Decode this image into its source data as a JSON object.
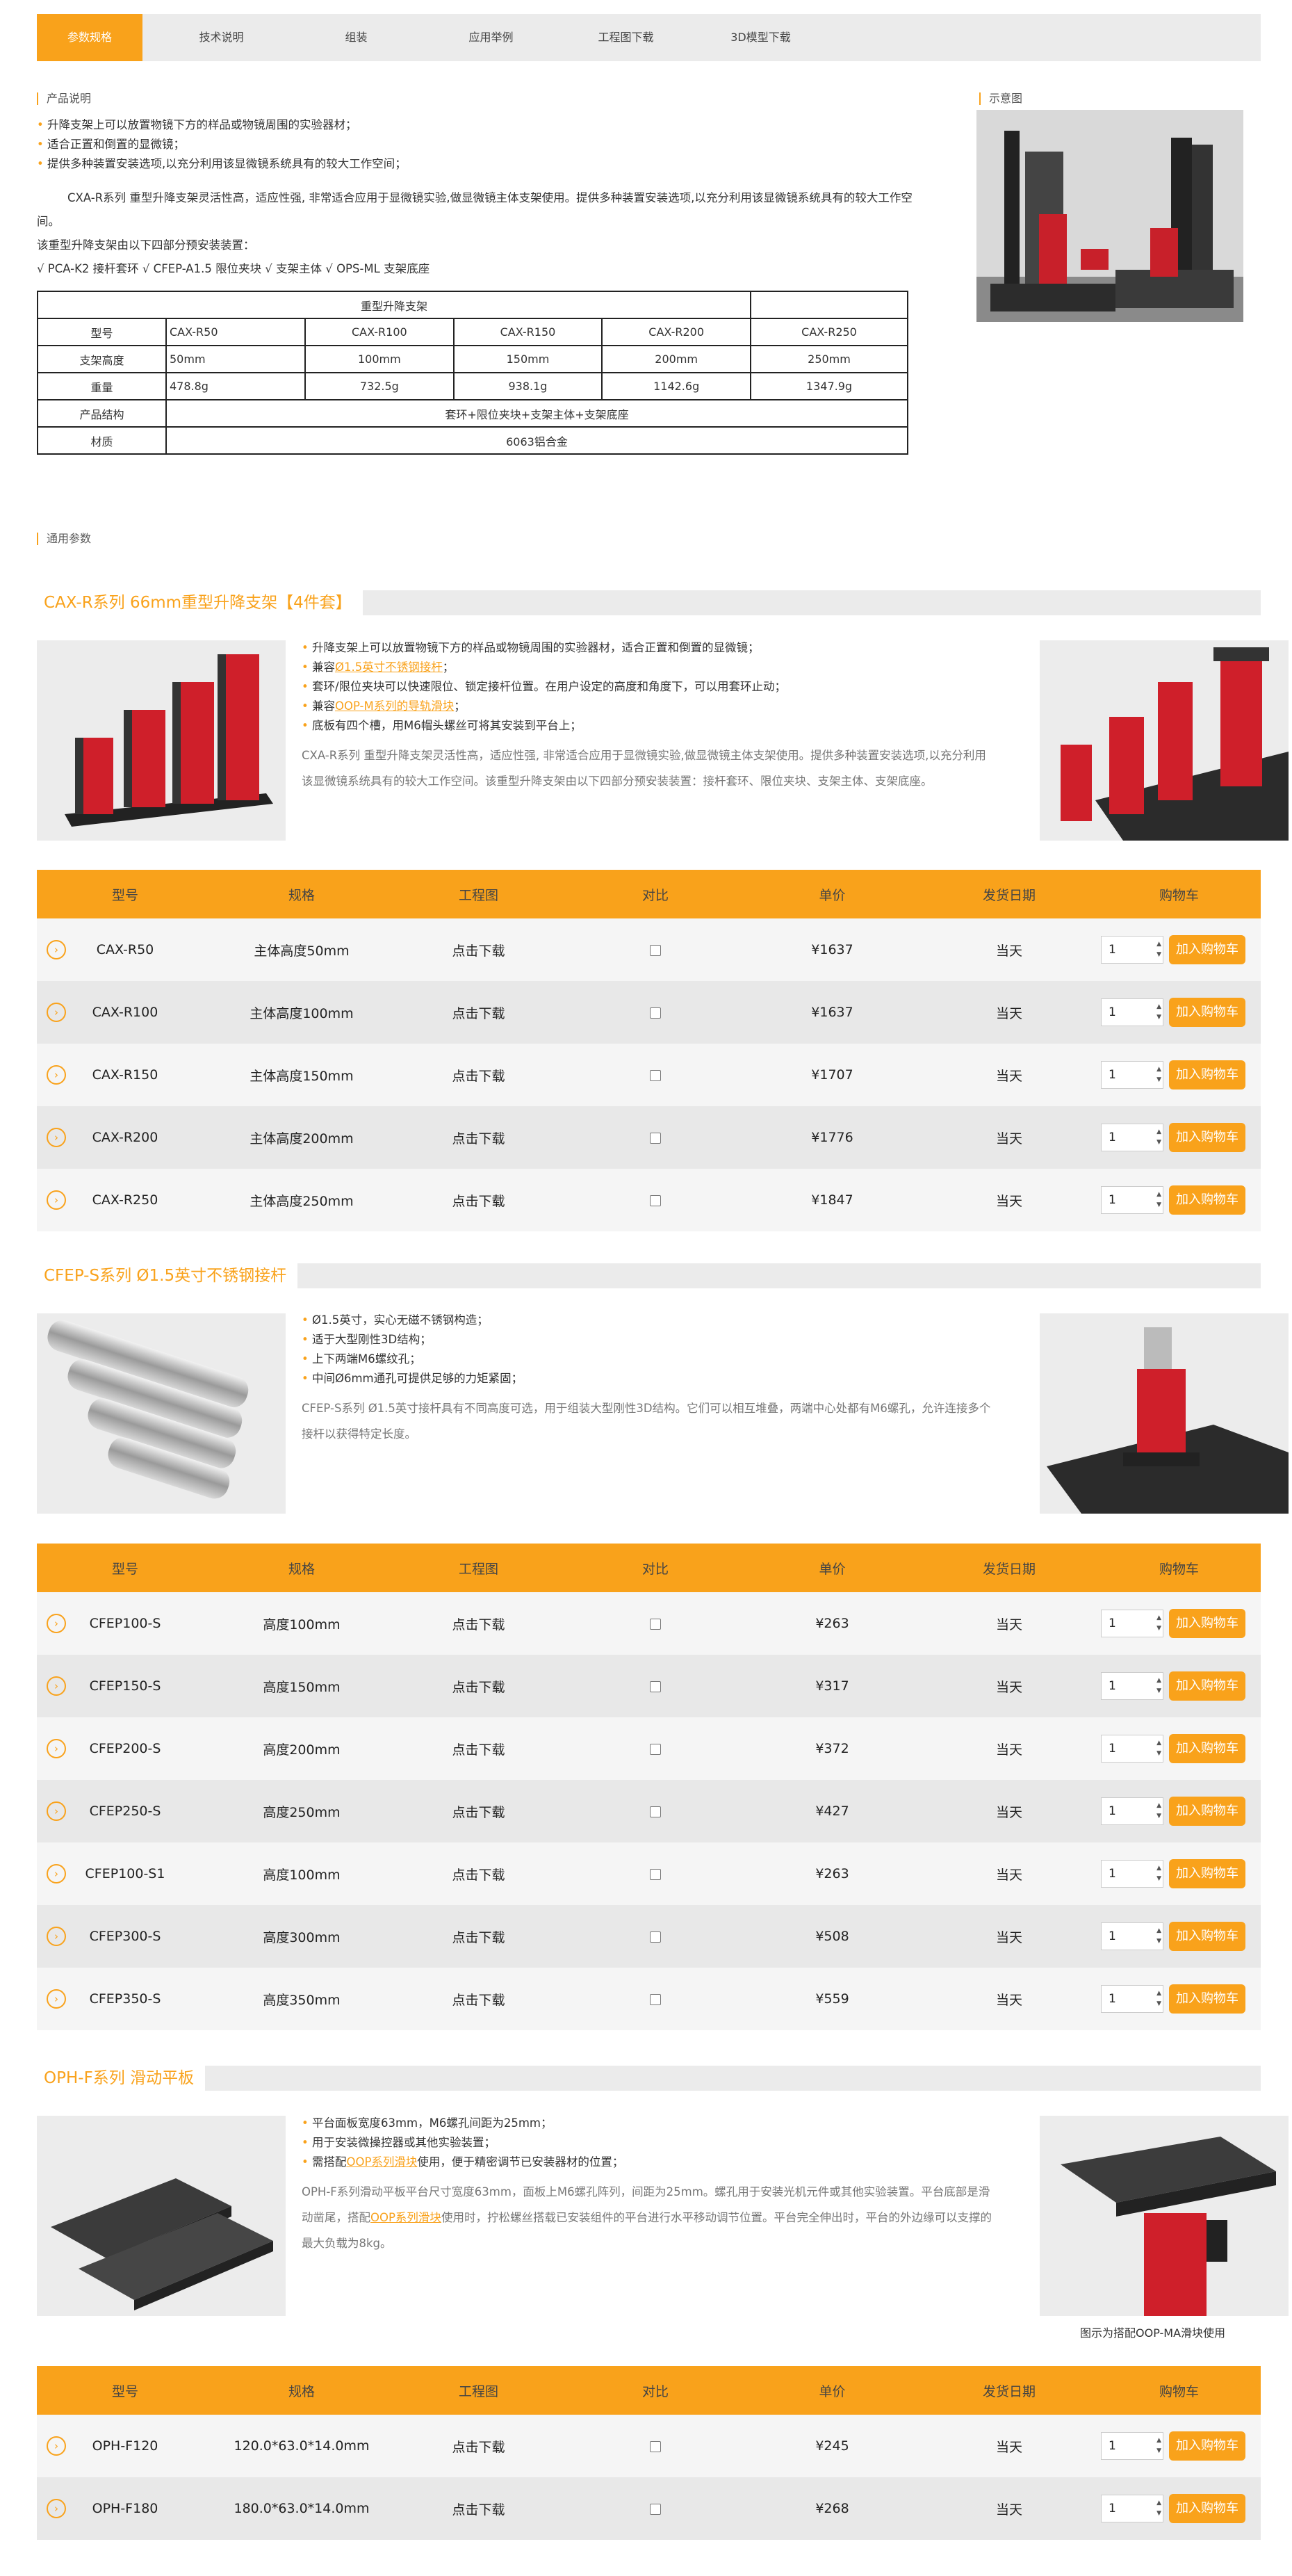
{
  "tabs": [
    "参数规格",
    "技术说明",
    "组装",
    "应用举例",
    "工程图下载",
    "3D模型下载"
  ],
  "sections": {
    "product_desc": "产品说明",
    "illustration": "示意图",
    "general": "通用参数"
  },
  "intro": {
    "bullets": [
      "升降支架上可以放置物镜下方的样品或物镜周围的实验器材；",
      "适合正置和倒置的显微镜；",
      "提供多种装置安装选项,以充分利用该显微镜系统具有的较大工作空间；"
    ],
    "para": "CXA-R系列 重型升降支架灵活性高，适应性强, 非常适合应用于显微镜实验,做显微镜主体支架使用。提供多种装置安装选项,以充分利用该显微镜系统具有的较大工作空间。",
    "para2": "该重型升降支架由以下四部分预安装装置：",
    "parts": "√ PCA-K2 接杆套环  √ CFEP-A1.5 限位夹块  √ 支架主体  √ OPS-ML 支架底座"
  },
  "spec": {
    "title": "重型升降支架",
    "row_model": [
      "型号",
      "CAX-R50",
      "CAX-R100",
      "CAX-R150",
      "CAX-R200",
      "CAX-R250"
    ],
    "row_height": [
      "支架高度",
      "50mm",
      "100mm",
      "150mm",
      "200mm",
      "250mm"
    ],
    "row_weight": [
      "重量",
      "478.8g",
      "732.5g",
      "938.1g",
      "1142.6g",
      "1347.9g"
    ],
    "row_struct": [
      "产品结构",
      "套环+限位夹块+支架主体+支架底座"
    ],
    "row_material": [
      "材质",
      "6063铝合金"
    ]
  },
  "columns": [
    "型号",
    "规格",
    "工程图",
    "对比",
    "单价",
    "发货日期",
    "购物车"
  ],
  "add_label": "加入购物车",
  "download": "点击下载",
  "ship": "当天",
  "qty": "1",
  "cat1": {
    "title": "CAX-R系列 66mm重型升降支架【4件套】",
    "bullets": [
      "升降支架上可以放置物镜下方的样品或物镜周围的实验器材，适合正置和倒置的显微镜；"
    ],
    "b2a": "兼容",
    "b2link": "Ø1.5英寸不锈钢接杆",
    "b2b": "；",
    "b3": "套环/限位夹块可以快速限位、锁定接杆位置。在用户设定的高度和角度下，可以用套环止动；",
    "b4a": "兼容",
    "b4link": "OOP-M系列的导轨滑块",
    "b4b": "；",
    "b5": "底板有四个槽，用M6帽头螺丝可将其安装到平台上；",
    "para": "CXA-R系列 重型升降支架灵活性高，适应性强, 非常适合应用于显微镜实验,做显微镜主体支架使用。提供多种装置安装选项,以充分利用该显微镜系统具有的较大工作空间。该重型升降支架由以下四部分预安装装置：接杆套环、限位夹块、支架主体、支架底座。",
    "rows": [
      [
        "CAX-R50",
        "主体高度50mm",
        "¥1637"
      ],
      [
        "CAX-R100",
        "主体高度100mm",
        "¥1637"
      ],
      [
        "CAX-R150",
        "主体高度150mm",
        "¥1707"
      ],
      [
        "CAX-R200",
        "主体高度200mm",
        "¥1776"
      ],
      [
        "CAX-R250",
        "主体高度250mm",
        "¥1847"
      ]
    ]
  },
  "cat2": {
    "title": "CFEP-S系列 Ø1.5英寸不锈钢接杆",
    "bullets": [
      "Ø1.5英寸，实心无磁不锈钢构造；",
      "适于大型刚性3D结构；",
      "上下两端M6螺纹孔；",
      "中间Ø6mm通孔可提供足够的力矩紧固；"
    ],
    "para": "CFEP-S系列 Ø1.5英寸接杆具有不同高度可选，用于组装大型刚性3D结构。它们可以相互堆叠，两端中心处都有M6螺孔，允许连接多个接杆以获得特定长度。",
    "rows": [
      [
        "CFEP100-S",
        "高度100mm",
        "¥263"
      ],
      [
        "CFEP150-S",
        "高度150mm",
        "¥317"
      ],
      [
        "CFEP200-S",
        "高度200mm",
        "¥372"
      ],
      [
        "CFEP250-S",
        "高度250mm",
        "¥427"
      ],
      [
        "CFEP100-S1",
        "高度100mm",
        "¥263"
      ],
      [
        "CFEP300-S",
        "高度300mm",
        "¥508"
      ],
      [
        "CFEP350-S",
        "高度350mm",
        "¥559"
      ]
    ]
  },
  "cat3": {
    "title": "OPH-F系列 滑动平板",
    "b1": "平台面板宽度63mm，M6螺孔间距为25mm；",
    "b2": "用于安装微操控器或其他实验装置；",
    "b3a": "需搭配",
    "b3link": "OOP系列滑块",
    "b3b": "使用，便于精密调节已安装器材的位置；",
    "para_a": "OPH-F系列滑动平板平台尺寸宽度63mm，面板上M6螺孔阵列，间距为25mm。螺孔用于安装光机元件或其他实验装置。平台底部是滑动凿尾，搭配",
    "para_link": "OOP系列滑块",
    "para_b": "使用时，拧松螺丝搭载已安装组件的平台进行水平移动调节位置。平台完全伸出时，平台的外边缘可以支撑的最大负载为8kg。",
    "caption": "图示为搭配OOP-MA滑块使用",
    "rows": [
      [
        "OPH-F120",
        "120.0*63.0*14.0mm",
        "¥245"
      ],
      [
        "OPH-F180",
        "180.0*63.0*14.0mm",
        "¥268"
      ]
    ]
  },
  "colors": {
    "accent": "#f9a21b",
    "red": "#d0202a"
  }
}
